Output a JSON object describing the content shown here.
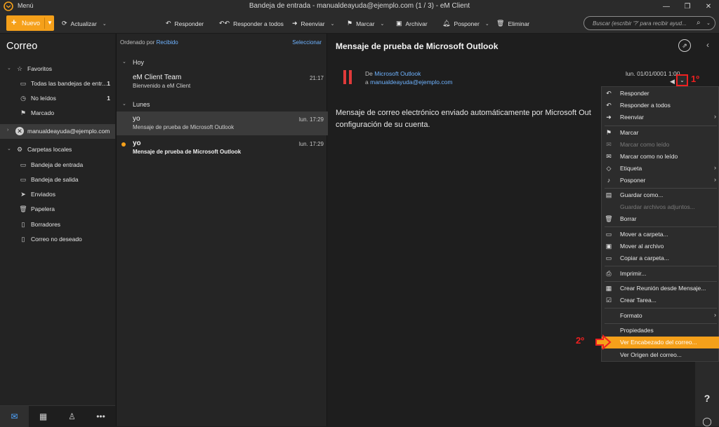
{
  "app": {
    "menu_label": "Menú",
    "window_title": "Bandeja de entrada - manualdeayuda@ejemplo.com (1 / 3) - eM Client"
  },
  "toolbar": {
    "new_label": "Nuevo",
    "refresh_label": "Actualizar",
    "reply_label": "Responder",
    "reply_all_label": "Responder a todos",
    "forward_label": "Reenviar",
    "flag_label": "Marcar",
    "archive_label": "Archivar",
    "snooze_label": "Posponer",
    "delete_label": "Eliminar",
    "search_placeholder": "Buscar (escribir '?' para recibir ayud..."
  },
  "sidebar": {
    "heading": "Correo",
    "favorites_label": "Favoritos",
    "favorites": [
      {
        "label": "Todas las bandejas de entr...",
        "count": "1"
      },
      {
        "label": "No leídos",
        "count": "1"
      },
      {
        "label": "Marcado",
        "count": ""
      }
    ],
    "account_label": "manualdeayuda@ejemplo.com",
    "local_folders_label": "Carpetas locales",
    "folders": [
      {
        "label": "Bandeja de entrada"
      },
      {
        "label": "Bandeja de salida"
      },
      {
        "label": "Enviados"
      },
      {
        "label": "Papelera"
      },
      {
        "label": "Borradores"
      },
      {
        "label": "Correo no deseado"
      }
    ]
  },
  "bottom_nav": [
    {
      "icon": "mail-icon"
    },
    {
      "icon": "calendar-icon"
    },
    {
      "icon": "contacts-icon"
    },
    {
      "icon": "more-icon"
    }
  ],
  "message_list": {
    "sort_prefix": "Ordenado por",
    "sort_field": "Recibido",
    "select_label": "Seleccionar",
    "groups": [
      {
        "label": "Hoy",
        "messages": [
          {
            "from": "eM Client Team",
            "subject": "Bienvenido a eM Client",
            "time": "21:17",
            "unread": false,
            "selected": false
          }
        ]
      },
      {
        "label": "Lunes",
        "messages": [
          {
            "from": "yo",
            "subject": "Mensaje de prueba de Microsoft Outlook",
            "time": "lun. 17:29",
            "unread": false,
            "selected": true
          },
          {
            "from": "yo",
            "subject": "Mensaje de prueba de Microsoft Outlook",
            "time": "lun. 17:29",
            "unread": true,
            "selected": false
          }
        ]
      }
    ]
  },
  "reading_pane": {
    "subject": "Mensaje de prueba de Microsoft Outlook",
    "from_prefix": "De",
    "from_name": "Microsoft Outlook",
    "to_prefix": "a",
    "to_address": "manualdeayuda@ejemplo.com",
    "date": "lun. 01/01/0001 1:00",
    "body_line1": "Mensaje de correo electrónico enviado automáticamente por Microsoft Out",
    "body_line2": "configuración de su cuenta."
  },
  "annotations": {
    "step1": "1º",
    "step2": "2º"
  },
  "context_menu": {
    "items": [
      {
        "label": "Responder",
        "icon": "reply-icon",
        "disabled": false,
        "submenu": false
      },
      {
        "label": "Responder a todos",
        "icon": "reply-all-icon",
        "disabled": false,
        "submenu": false
      },
      {
        "label": "Reenviar",
        "icon": "forward-icon",
        "disabled": false,
        "submenu": true
      },
      {
        "label": "Marcar",
        "icon": "flag-icon",
        "disabled": false,
        "submenu": false
      },
      {
        "label": "Marcar como leído",
        "icon": "mark-read-icon",
        "disabled": true,
        "submenu": false
      },
      {
        "label": "Marcar como no leído",
        "icon": "mark-unread-icon",
        "disabled": false,
        "submenu": false
      },
      {
        "label": "Etiqueta",
        "icon": "tag-icon",
        "disabled": false,
        "submenu": true
      },
      {
        "label": "Posponer",
        "icon": "bell-icon",
        "disabled": false,
        "submenu": true
      },
      {
        "label": "Guardar como...",
        "icon": "save-icon",
        "disabled": false,
        "submenu": false
      },
      {
        "label": "Guardar archivos adjuntos...",
        "icon": "",
        "disabled": true,
        "submenu": false
      },
      {
        "label": "Borrar",
        "icon": "trash-icon",
        "disabled": false,
        "submenu": false
      },
      {
        "label": "Mover a carpeta...",
        "icon": "move-icon",
        "disabled": false,
        "submenu": false
      },
      {
        "label": "Mover al archivo",
        "icon": "archive-icon",
        "disabled": false,
        "submenu": false
      },
      {
        "label": "Copiar a carpeta...",
        "icon": "copy-folder-icon",
        "disabled": false,
        "submenu": false
      },
      {
        "label": "Imprimir...",
        "icon": "print-icon",
        "disabled": false,
        "submenu": false
      },
      {
        "label": "Crear Reunión desde Mensaje...",
        "icon": "meeting-icon",
        "disabled": false,
        "submenu": false
      },
      {
        "label": "Crear Tarea...",
        "icon": "task-icon",
        "disabled": false,
        "submenu": false
      },
      {
        "label": "Formato",
        "icon": "",
        "disabled": false,
        "submenu": true
      },
      {
        "label": "Propiedades",
        "icon": "",
        "disabled": false,
        "submenu": false
      },
      {
        "label": "Ver Encabezado del correo...",
        "icon": "",
        "disabled": false,
        "submenu": false,
        "highlighted": true
      },
      {
        "label": "Ver Origen del correo...",
        "icon": "",
        "disabled": false,
        "submenu": false
      }
    ]
  },
  "colors": {
    "accent": "#f5a01a",
    "link": "#6fb3ff",
    "annotation": "#ee2020"
  }
}
